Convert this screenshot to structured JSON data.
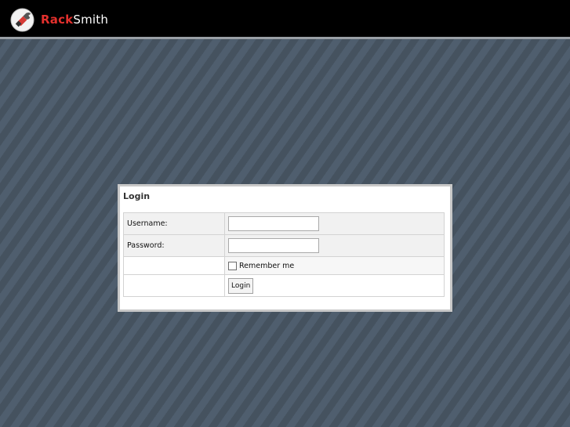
{
  "header": {
    "logo_icon": "wrench-in-circle-icon",
    "brand_part1": "Rack",
    "brand_part2": "Smith",
    "brand_color": "#e2302d"
  },
  "login": {
    "title": "Login",
    "username_label": "Username:",
    "username_value": "",
    "password_label": "Password:",
    "password_value": "",
    "remember_label": "Remember me",
    "remember_checked": false,
    "submit_label": "Login"
  }
}
